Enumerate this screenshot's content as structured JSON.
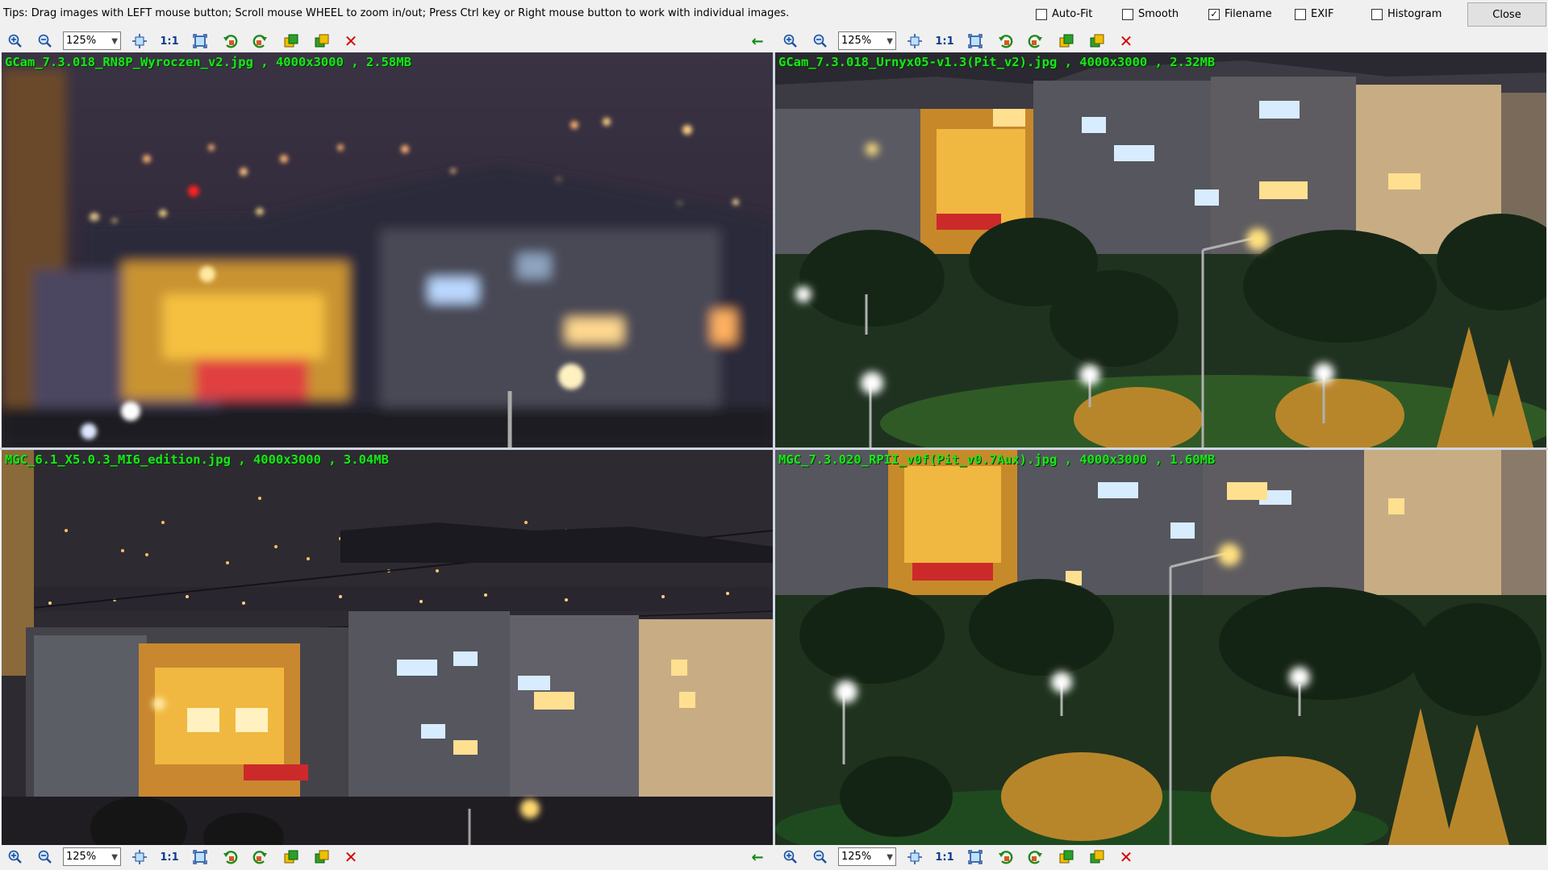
{
  "tips": "Tips: Drag images with LEFT mouse button; Scroll mouse WHEEL to zoom in/out; Press Ctrl key or Right mouse button to work with individual images.",
  "options": [
    {
      "label": "Auto-Fit",
      "checked": false
    },
    {
      "label": "Smooth",
      "checked": false
    },
    {
      "label": "Filename",
      "checked": true
    },
    {
      "label": "EXIF",
      "checked": false
    },
    {
      "label": "Histogram",
      "checked": false
    }
  ],
  "close_label": "Close",
  "toolbar": {
    "zoom_value": "125%",
    "one_to_one": "1:1",
    "icons": [
      "zoom-in-icon",
      "zoom-out-icon",
      "fit-icon",
      "actual-size-icon",
      "fullscreen-icon",
      "rotate-left-icon",
      "rotate-right-icon",
      "copy-icon",
      "save-icon",
      "close-image-icon",
      "sync-arrow-icon"
    ]
  },
  "images": [
    {
      "filename": "GCam_7.3.018_RN8P_Wyroczen_v2.jpg",
      "dimensions": "4000x3000",
      "size": "2.58MB"
    },
    {
      "filename": "GCam_7.3.018_Urnyx05-v1.3(Pit_v2).jpg",
      "dimensions": "4000x3000",
      "size": "2.32MB"
    },
    {
      "filename": "MGC_6.1_X5.0.3_MI6_edition.jpg",
      "dimensions": "4000x3000",
      "size": "3.04MB"
    },
    {
      "filename": "MGC_7.3.020_RPII_v0f(Pit_v0.7Aux).jpg",
      "dimensions": "4000x3000",
      "size": "1.60MB"
    }
  ],
  "captions": {
    "tl": "GCam_7.3.018_RN8P_Wyroczen_v2.jpg , 4000x3000 , 2.58MB",
    "tr": "GCam_7.3.018_Urnyx05-v1.3(Pit_v2).jpg , 4000x3000 , 2.32MB",
    "bl": "MGC_6.1_X5.0.3_MI6_edition.jpg , 4000x3000 , 3.04MB",
    "br": "MGC_7.3.020_RPII_v0f(Pit_v0.7Aux).jpg , 4000x3000 , 1.60MB"
  },
  "colors": {
    "caption": "#19e619",
    "night_sky": "#2a2636",
    "building_yellow": "#e0a020",
    "grass": "#1f3a1a",
    "close_x": "#d40000"
  }
}
